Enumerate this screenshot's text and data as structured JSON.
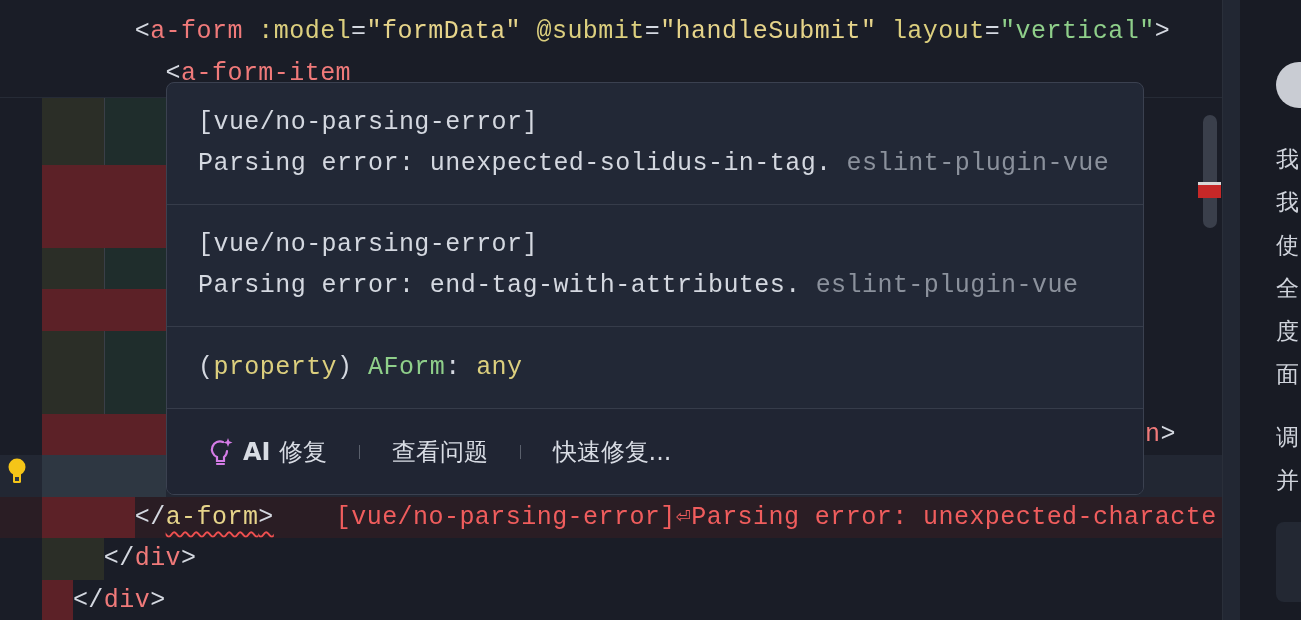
{
  "sticky_lines": [
    {
      "tokens": [
        {
          "text": "      <",
          "kind": "punct"
        },
        {
          "text": "a-form",
          "kind": "tag"
        },
        {
          "text": " :model",
          "kind": "attr"
        },
        {
          "text": "=",
          "kind": "punct"
        },
        {
          "text": "\"formData\"",
          "kind": "string"
        },
        {
          "text": " @submit",
          "kind": "attr"
        },
        {
          "text": "=",
          "kind": "punct"
        },
        {
          "text": "\"handleSubmit\"",
          "kind": "string"
        },
        {
          "text": " layout",
          "kind": "attr"
        },
        {
          "text": "=",
          "kind": "punct"
        },
        {
          "text": "\"vertical\"",
          "kind": "value"
        },
        {
          "text": ">",
          "kind": "punct"
        }
      ]
    },
    {
      "tokens": [
        {
          "text": "        <",
          "kind": "punct"
        },
        {
          "text": "a-form-item",
          "kind": "tag"
        }
      ]
    }
  ],
  "lines": [
    {
      "kind": "hidden",
      "error": false
    },
    {
      "kind": "hidden",
      "error": false
    },
    {
      "kind": "hidden",
      "error": true
    },
    {
      "kind": "hidden",
      "error": true
    },
    {
      "kind": "hidden",
      "error": false
    },
    {
      "kind": "hidden",
      "error": true
    },
    {
      "kind": "hidden",
      "error": false
    },
    {
      "kind": "hidden",
      "error": false
    },
    {
      "kind": "tail",
      "error": true,
      "tokens": [
        {
          "text": "n",
          "kind": "tag"
        },
        {
          "text": ">",
          "kind": "punct"
        }
      ]
    },
    {
      "kind": "current"
    },
    {
      "kind": "code",
      "error": true,
      "tokens": [
        {
          "text": "      </",
          "kind": "punct"
        },
        {
          "text": "a-form",
          "kind": "string",
          "squiggle": true
        },
        {
          "text": ">",
          "kind": "punct",
          "squiggle": true
        }
      ],
      "inline_error": "[vue/no-parsing-error]⏎Parsing error: unexpected-characte"
    },
    {
      "kind": "code",
      "error": false,
      "tokens": [
        {
          "text": "    </",
          "kind": "punct"
        },
        {
          "text": "div",
          "kind": "tag"
        },
        {
          "text": ">",
          "kind": "punct"
        }
      ]
    },
    {
      "kind": "code",
      "error": true,
      "tokens": [
        {
          "text": "  </",
          "kind": "punct"
        },
        {
          "text": "div",
          "kind": "tag"
        },
        {
          "text": ">",
          "kind": "punct"
        }
      ]
    }
  ],
  "hover": {
    "problems": [
      {
        "rule": "[vue/no-parsing-error]",
        "message": "Parsing error: unexpected-solidus-in-tag.",
        "source": "eslint-plugin-vue"
      },
      {
        "rule": "[vue/no-parsing-error]",
        "message": "Parsing error: end-tag-with-attributes.",
        "source": "eslint-plugin-vue"
      }
    ],
    "signature": [
      {
        "text": "(",
        "kind": "punct"
      },
      {
        "text": "property",
        "kind": "attr"
      },
      {
        "text": ") ",
        "kind": "punct"
      },
      {
        "text": "AForm",
        "kind": "value"
      },
      {
        "text": ": ",
        "kind": "punct"
      },
      {
        "text": "any",
        "kind": "attr"
      }
    ],
    "actions": [
      {
        "kind": "ai",
        "label": "AI",
        "label_rest": "修复"
      },
      {
        "kind": "plain",
        "label": "查看问题"
      },
      {
        "kind": "plain",
        "label": "快速修复..."
      }
    ]
  },
  "side_panel": {
    "paragraphs": [
      [
        "我",
        "我",
        "使",
        "全",
        "度",
        "面"
      ],
      [
        "调",
        "并"
      ]
    ]
  }
}
